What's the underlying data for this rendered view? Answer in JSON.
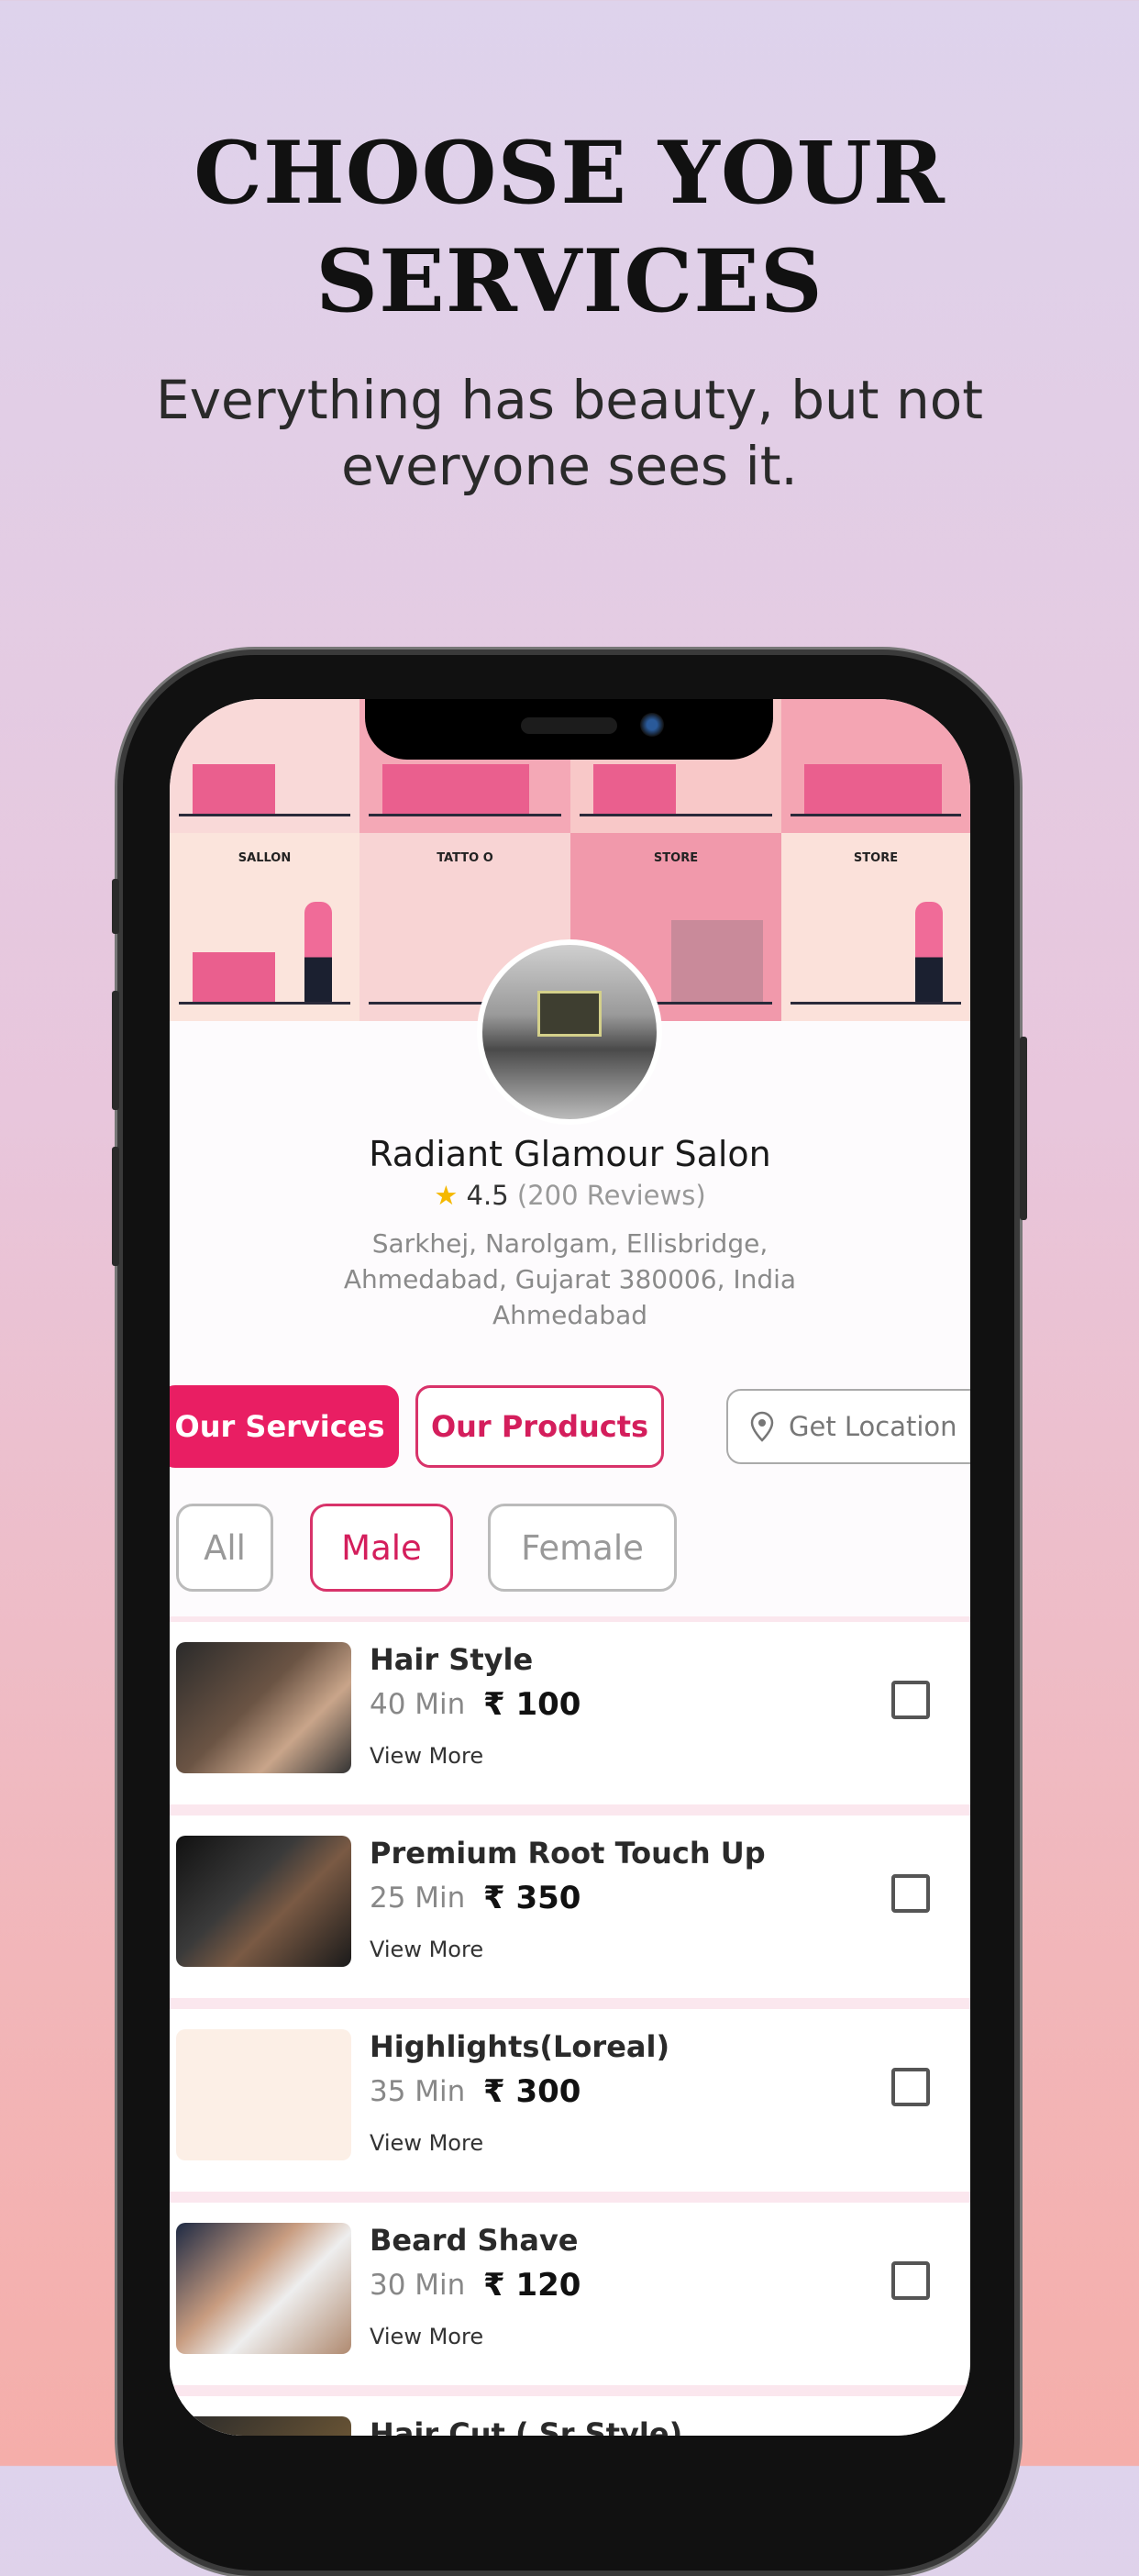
{
  "hero": {
    "title_line1": "CHOOSE YOUR",
    "title_line2": "SERVICES",
    "subtitle_line1": "Everything has beauty, but not",
    "subtitle_line2": "everyone sees it."
  },
  "banner": {
    "tiles": [
      "",
      "",
      "",
      "",
      "SALLON",
      "TATTO O",
      "STORE",
      "STORE"
    ]
  },
  "salon": {
    "name": "Radiant Glamour Salon",
    "rating": "4.5",
    "reviews": "(200 Reviews)",
    "address_line1": "Sarkhej, Narolgam, Ellisbridge,",
    "address_line2": "Ahmedabad, Gujarat 380006, India",
    "city": "Ahmedabad"
  },
  "tabs": {
    "services": "Our Services",
    "products": "Our Products",
    "location": "Get Location",
    "active": "Our Services"
  },
  "filters": {
    "all": "All",
    "male": "Male",
    "female": "Female",
    "active": "Male"
  },
  "services": [
    {
      "name": "Hair Style",
      "duration": "40 Min",
      "price": "₹ 100",
      "view_more": "View More",
      "checked": false
    },
    {
      "name": "Premium Root Touch Up",
      "duration": "25 Min",
      "price": "₹ 350",
      "view_more": "View More",
      "checked": false
    },
    {
      "name": "Highlights(Loreal)",
      "duration": "35 Min",
      "price": "₹ 300",
      "view_more": "View More",
      "checked": false
    },
    {
      "name": "Beard Shave",
      "duration": "30 Min",
      "price": "₹ 120",
      "view_more": "View More",
      "checked": false
    },
    {
      "name": "Hair Cut ( Sr Style)",
      "duration": "",
      "price": "",
      "view_more": "",
      "checked": false
    }
  ],
  "colors": {
    "accent": "#e91e63",
    "background_top": "#ded3ec",
    "background_bottom": "#f5aeaa"
  }
}
